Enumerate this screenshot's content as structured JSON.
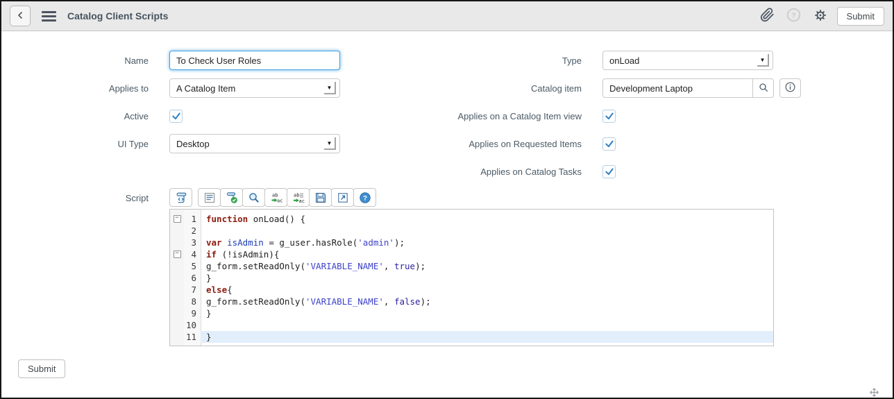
{
  "header": {
    "title": "Catalog Client Scripts",
    "submit_label": "Submit",
    "icons": [
      "back-icon",
      "menu-icon",
      "attachment-icon",
      "help-icon",
      "settings-icon"
    ]
  },
  "form": {
    "name": {
      "label": "Name",
      "value": "To Check User Roles"
    },
    "applies_to": {
      "label": "Applies to",
      "value": "A Catalog Item"
    },
    "active": {
      "label": "Active",
      "checked": true
    },
    "ui_type": {
      "label": "UI Type",
      "value": "Desktop"
    },
    "type": {
      "label": "Type",
      "value": "onLoad"
    },
    "catalog_item": {
      "label": "Catalog item",
      "value": "Development Laptop"
    },
    "applies_on_catalog_item_view": {
      "label": "Applies on a Catalog Item view",
      "checked": true
    },
    "applies_on_requested_items": {
      "label": "Applies on Requested Items",
      "checked": true
    },
    "applies_on_catalog_tasks": {
      "label": "Applies on Catalog Tasks",
      "checked": true
    }
  },
  "script": {
    "label": "Script",
    "toolbar_icons": [
      "format-code-icon",
      "comment-icon",
      "syntax-check-icon",
      "find-icon",
      "replace-icon",
      "replace-all-icon",
      "save-icon",
      "pop-out-icon",
      "editor-help-icon"
    ],
    "active_line": 11,
    "lines": [
      {
        "n": 1,
        "fold": true,
        "seg": [
          [
            "function",
            "kw"
          ],
          [
            " onLoad() {",
            "pl"
          ]
        ]
      },
      {
        "n": 2,
        "seg": []
      },
      {
        "n": 3,
        "seg": [
          [
            "var",
            "kw"
          ],
          [
            " ",
            "pl"
          ],
          [
            "isAdmin",
            "def"
          ],
          [
            " = g_user.hasRole(",
            "pl"
          ],
          [
            "'admin'",
            "str"
          ],
          [
            ");",
            "pl"
          ]
        ]
      },
      {
        "n": 4,
        "fold": true,
        "seg": [
          [
            "if",
            "kw"
          ],
          [
            " (!isAdmin){",
            "pl"
          ]
        ]
      },
      {
        "n": 5,
        "seg": [
          [
            "g_form.setReadOnly(",
            "pl"
          ],
          [
            "'VARIABLE_NAME'",
            "str"
          ],
          [
            ", ",
            "pl"
          ],
          [
            "true",
            "atom"
          ],
          [
            ");",
            "pl"
          ]
        ]
      },
      {
        "n": 6,
        "seg": [
          [
            "}",
            "pl"
          ]
        ]
      },
      {
        "n": 7,
        "seg": [
          [
            "else",
            "kw"
          ],
          [
            "{",
            "pl"
          ]
        ]
      },
      {
        "n": 8,
        "seg": [
          [
            "g_form.setReadOnly(",
            "pl"
          ],
          [
            "'VARIABLE_NAME'",
            "str"
          ],
          [
            ", ",
            "pl"
          ],
          [
            "false",
            "atom"
          ],
          [
            ");",
            "pl"
          ]
        ]
      },
      {
        "n": 9,
        "seg": [
          [
            "}",
            "pl"
          ]
        ]
      },
      {
        "n": 10,
        "seg": []
      },
      {
        "n": 11,
        "active": true,
        "seg": [
          [
            "}",
            "pl"
          ]
        ]
      }
    ]
  },
  "footer": {
    "submit_label": "Submit"
  }
}
